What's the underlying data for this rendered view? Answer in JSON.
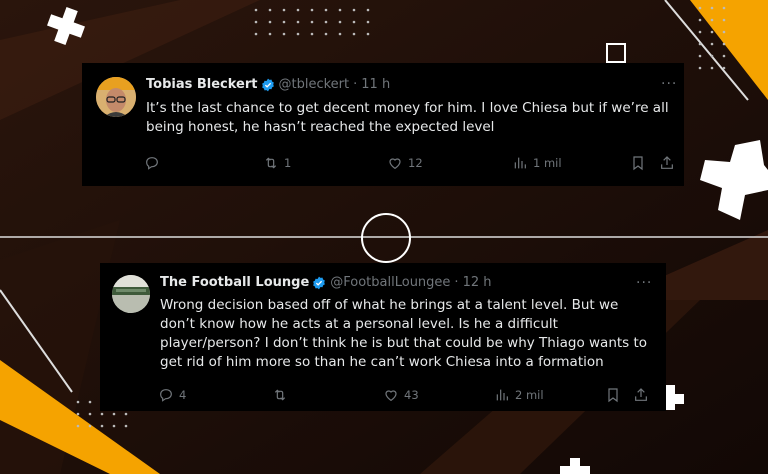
{
  "tweets": [
    {
      "display_name": "Tobias Bleckert",
      "handle": "@tbleckert",
      "separator": "·",
      "time": "11 h",
      "text": "It’s the last chance to get decent money for him. I love Chiesa but if we’re all being honest, he hasn’t reached the expected level",
      "replies": "",
      "retweets": "1",
      "likes": "12",
      "views": "1 mil",
      "more_label": "···"
    },
    {
      "display_name": "The Football Lounge",
      "handle": "@FootballLoungee",
      "separator": "·",
      "time": "12 h",
      "text": "Wrong decision based off of what he brings at a talent level. But we don’t know how he acts at a personal level. Is he a difficult player/person?  I don’t think he is but that could be why Thiago wants to get rid of him more so than he can’t work Chiesa into a formation",
      "replies": "4",
      "retweets": "",
      "likes": "43",
      "views": "2 mil",
      "more_label": "···"
    }
  ],
  "colors": {
    "background": "#1a0d08",
    "accent_orange": "#f5a300",
    "card": "#000000",
    "verified_blue": "#1d9bf0",
    "muted_text": "#71767b"
  }
}
